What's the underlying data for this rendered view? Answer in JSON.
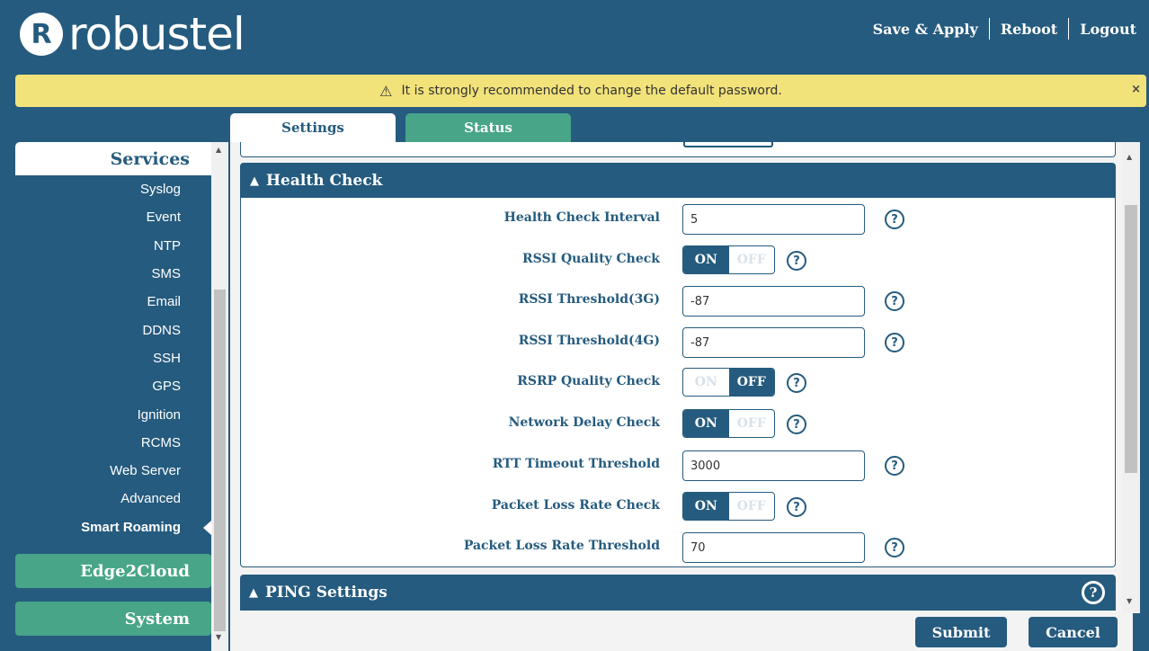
{
  "brand": {
    "mark": "R",
    "name": "robustel"
  },
  "header": {
    "links": [
      "Save & Apply",
      "Reboot",
      "Logout"
    ]
  },
  "banner": {
    "icon": "warning-triangle-icon",
    "text": "It is strongly recommended to change the default password.",
    "close": "×"
  },
  "tabs": {
    "settings": "Settings",
    "status": "Status"
  },
  "sidebar": {
    "section": "Services",
    "items": [
      "Syslog",
      "Event",
      "NTP",
      "SMS",
      "Email",
      "DDNS",
      "SSH",
      "GPS",
      "Ignition",
      "RCMS",
      "Web Server",
      "Advanced",
      "Smart Roaming"
    ],
    "active": "Smart Roaming",
    "groups": [
      "Edge2Cloud",
      "System"
    ]
  },
  "health": {
    "title": "Health Check",
    "interval": {
      "label": "Health Check Interval",
      "value": "5"
    },
    "rssi_check": {
      "label": "RSSI Quality Check",
      "on": "ON",
      "off": "OFF",
      "state": "on"
    },
    "rssi_3g": {
      "label": "RSSI Threshold(3G)",
      "value": "-87"
    },
    "rssi_4g": {
      "label": "RSSI Threshold(4G)",
      "value": "-87"
    },
    "rsrp_check": {
      "label": "RSRP Quality Check",
      "on": "ON",
      "off": "OFF",
      "state": "off"
    },
    "delay_check": {
      "label": "Network Delay Check",
      "on": "ON",
      "off": "OFF",
      "state": "on"
    },
    "rtt": {
      "label": "RTT Timeout Threshold",
      "value": "3000"
    },
    "loss_check": {
      "label": "Packet Loss Rate Check",
      "on": "ON",
      "off": "OFF",
      "state": "on"
    },
    "loss_threshold": {
      "label": "Packet Loss Rate Threshold",
      "value": "70"
    }
  },
  "ping": {
    "title": "PING Settings"
  },
  "help_glyph": "?",
  "chevron_up": "^",
  "actions": {
    "submit": "Submit",
    "cancel": "Cancel"
  },
  "colors": {
    "primary": "#255b7e",
    "accent": "#48a587",
    "banner": "#f2e27a"
  }
}
